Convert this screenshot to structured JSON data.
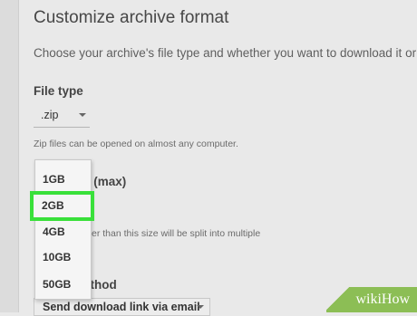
{
  "title": "Customize archive format",
  "subtitle": "Choose your archive's file type and whether you want to download it or sa",
  "file_type": {
    "label": "File type",
    "selected": ".zip",
    "hint": "Zip files can be opened on almost any computer."
  },
  "archive_size": {
    "label_visible": "e (max)",
    "split_text": "er than this size will be split into multiple",
    "options": [
      "1GB",
      "2GB",
      "4GB",
      "10GB",
      "50GB"
    ],
    "highlighted": "2GB"
  },
  "delivery": {
    "label_visible": "ethod",
    "selected": "Send download link via email"
  },
  "watermark": {
    "text": "wikiHow"
  },
  "colors": {
    "highlight": "#39e03a",
    "watermark_bg": "#8cbe55"
  }
}
